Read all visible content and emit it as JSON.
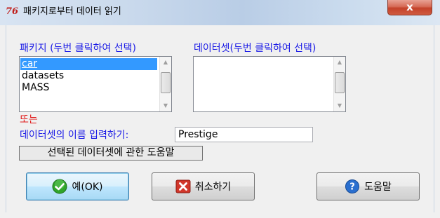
{
  "window": {
    "title": "패키지로부터 데이터 읽기",
    "app_icon_text": "76",
    "close_glyph": "x"
  },
  "packages": {
    "label": "패키지 (두번 클릭하여 선택)",
    "items": [
      "car",
      "datasets",
      "MASS"
    ],
    "selected_index": 0
  },
  "datasets": {
    "label": "데이터셋(두번 클릭하여 선택)",
    "items": []
  },
  "or_label": "또는",
  "dataset_name": {
    "label": "데이터셋의 이름 입력하기:",
    "value": "Prestige"
  },
  "help_selected_button": "선택된 데이터셋에 관한 도움말",
  "buttons": {
    "ok": "예(OK)",
    "cancel": "취소하기",
    "help": "도움말"
  },
  "colors": {
    "label_blue": "#1a1ae6",
    "label_red": "#e01818",
    "selection": "#3399ff",
    "ok_icon": "#2fa52a",
    "cancel_icon": "#d2372b",
    "help_icon": "#2a6fcf"
  },
  "icons": {
    "ok": "check-circle-icon",
    "cancel": "x-box-icon",
    "help": "question-circle-icon",
    "close": "close-icon",
    "app": "r-commander-icon"
  }
}
